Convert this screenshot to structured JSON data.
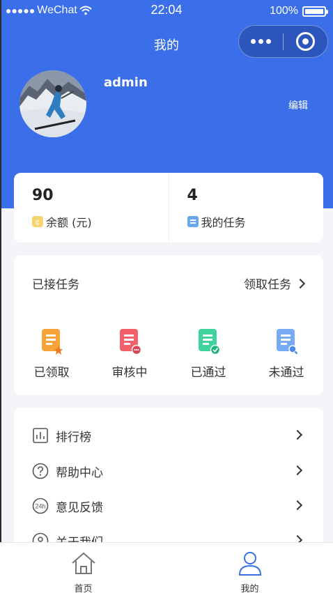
{
  "status_bar": {
    "carrier": "WeChat",
    "time": "22:04",
    "battery": "100%"
  },
  "nav": {
    "title": "我的"
  },
  "profile": {
    "username": "admin",
    "edit_label": "编辑"
  },
  "stats": [
    {
      "value": "90",
      "label": "余额 (元)",
      "icon": "coin-icon"
    },
    {
      "value": "4",
      "label": "我的任务",
      "icon": "task-list-icon"
    }
  ],
  "tasks": {
    "title": "已接任务",
    "link_label": "领取任务",
    "items": [
      {
        "label": "已领取",
        "icon": "document-star-icon",
        "color": "#f6a43a"
      },
      {
        "label": "审核中",
        "icon": "document-pending-icon",
        "color": "#f2606a"
      },
      {
        "label": "已通过",
        "icon": "document-check-icon",
        "color": "#3ed39a"
      },
      {
        "label": "未通过",
        "icon": "document-search-icon",
        "color": "#78a9f4"
      }
    ]
  },
  "menu": [
    {
      "label": "排行榜",
      "icon": "bar-chart-icon"
    },
    {
      "label": "帮助中心",
      "icon": "question-icon"
    },
    {
      "label": "意见反馈",
      "icon": "24h-icon"
    },
    {
      "label": "关于我们",
      "icon": "info-icon"
    }
  ],
  "tabbar": [
    {
      "label": "首页",
      "icon": "home-icon"
    },
    {
      "label": "我的",
      "icon": "user-icon",
      "active": true
    }
  ],
  "colors": {
    "primary": "#3b6fe9",
    "background": "#f3f5f8",
    "card": "#ffffff",
    "text": "#333333"
  }
}
